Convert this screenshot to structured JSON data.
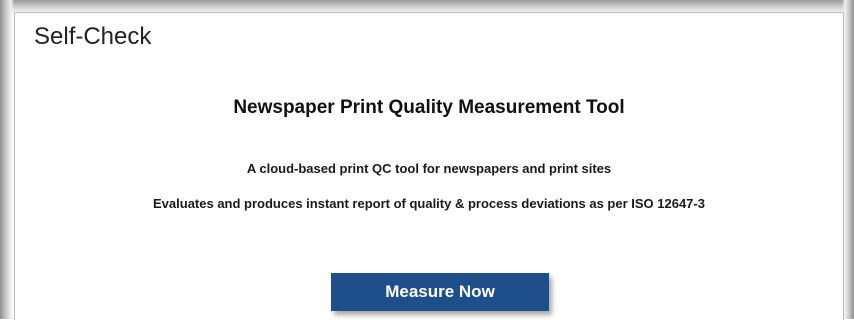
{
  "page": {
    "title": "Self-Check"
  },
  "content": {
    "tool_title": "Newspaper Print Quality Measurement Tool",
    "tagline": "A cloud-based print QC tool for newspapers and print sites",
    "description": "Evaluates and produces instant report of quality & process deviations as per ISO 12647-3"
  },
  "actions": {
    "measure_label": "Measure Now"
  },
  "colors": {
    "button_background": "#1f4f8a",
    "button_text": "#ffffff",
    "text_primary": "#111111"
  }
}
